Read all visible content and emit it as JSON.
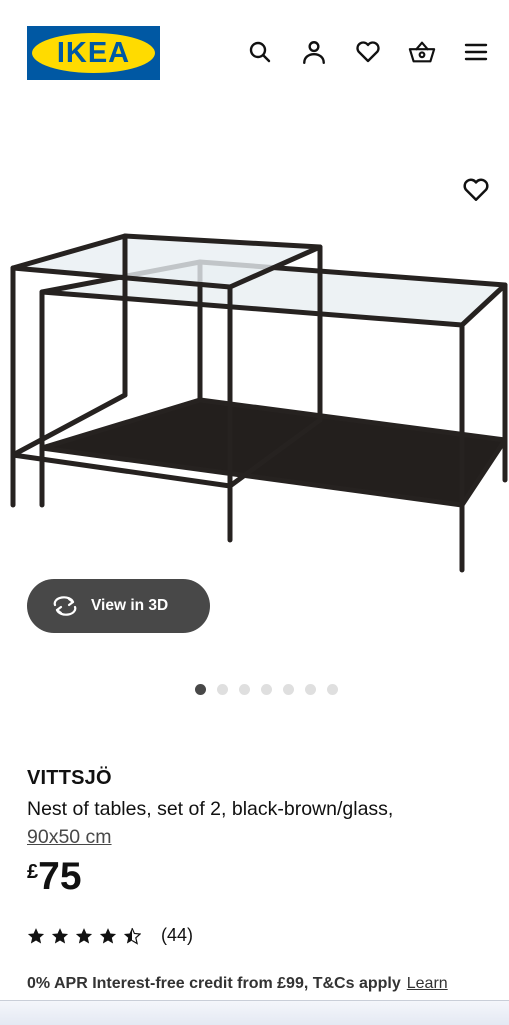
{
  "header": {
    "logo_text": "IKEA",
    "icons": [
      "search-icon",
      "user-icon",
      "heart-icon",
      "basket-icon",
      "menu-icon"
    ]
  },
  "gallery": {
    "view3d_label": "View in 3D",
    "dot_count": 7,
    "active_dot": 0
  },
  "product": {
    "name": "VITTSJÖ",
    "description": "Nest of tables, set of 2, black-brown/glass,",
    "size": "90x50 cm",
    "currency": "£",
    "price": "75",
    "rating_value": 4.5,
    "rating_count": "(44)"
  },
  "finance": {
    "text": "0% APR Interest-free credit from £99, T&Cs apply",
    "learn_label": "Learn"
  },
  "colors": {
    "ikea_blue": "#0058a3",
    "ikea_yellow": "#ffdb00",
    "button_dark": "#484848"
  }
}
